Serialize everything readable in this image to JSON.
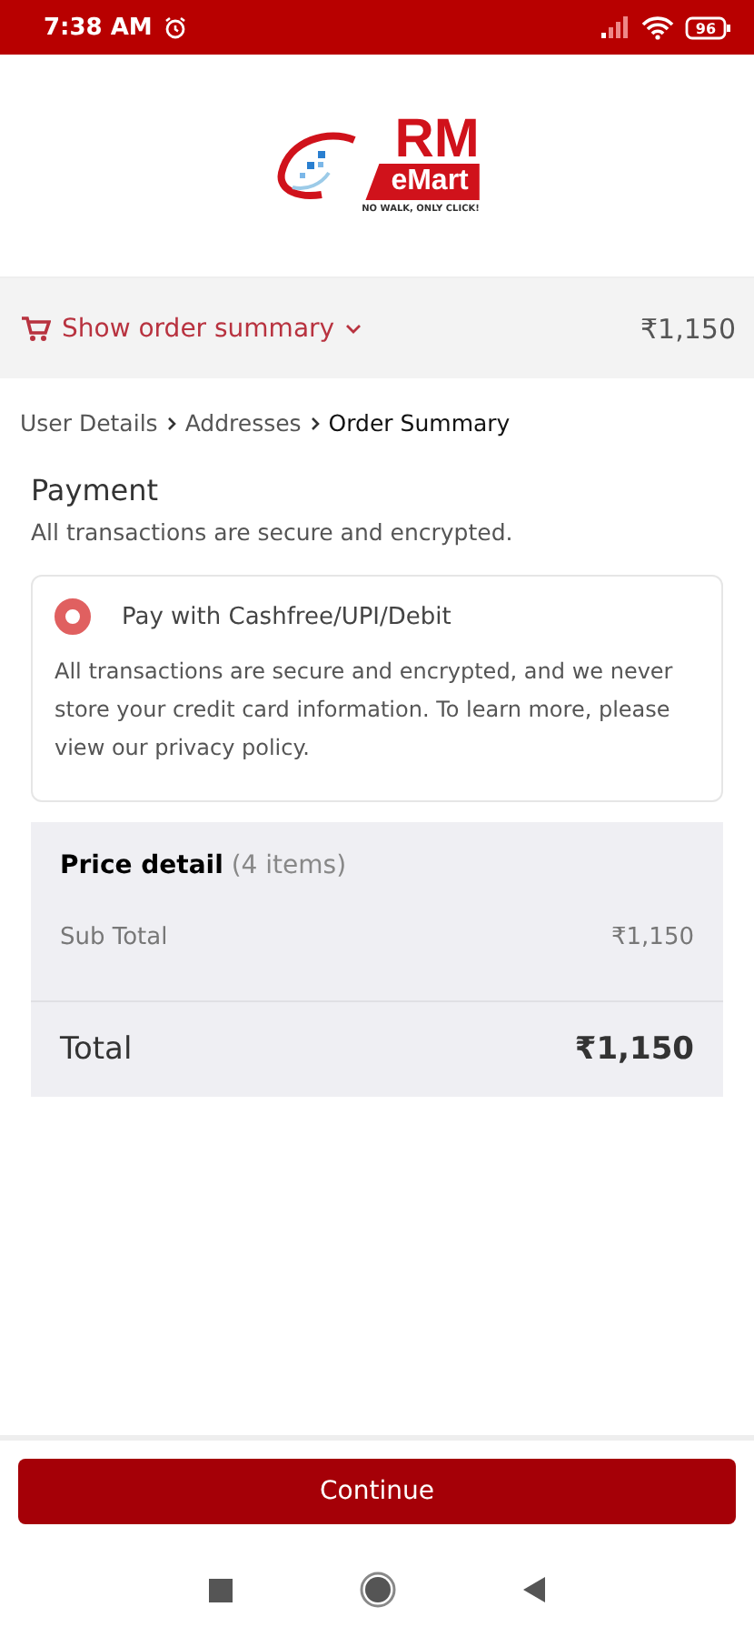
{
  "status_bar": {
    "time": "7:38 AM",
    "battery": "96"
  },
  "logo": {
    "title": "RM",
    "subtitle": "eMart",
    "tagline": "NO WALK, ONLY CLICK!"
  },
  "order_summary": {
    "label": "Show order summary",
    "total": "₹1,150",
    "expanded": false
  },
  "breadcrumb": [
    {
      "label": "User Details",
      "selected": false
    },
    {
      "label": "Addresses",
      "selected": false
    },
    {
      "label": "Order Summary",
      "selected": true
    }
  ],
  "payment": {
    "title": "Payment",
    "subtitle": "All transactions are secure and encrypted.",
    "options": [
      {
        "label": "Pay with Cashfree/UPI/Debit",
        "selected": true,
        "description": "All transactions are secure and encrypted, and we never store your credit card information. To learn more, please view our privacy policy."
      }
    ]
  },
  "price_detail": {
    "title": "Price detail",
    "count": "(4 items)",
    "rows": [
      {
        "label": "Sub Total",
        "value": "₹1,150"
      }
    ],
    "total_label": "Total",
    "total_value": "₹1,150"
  },
  "continue_button": "Continue"
}
